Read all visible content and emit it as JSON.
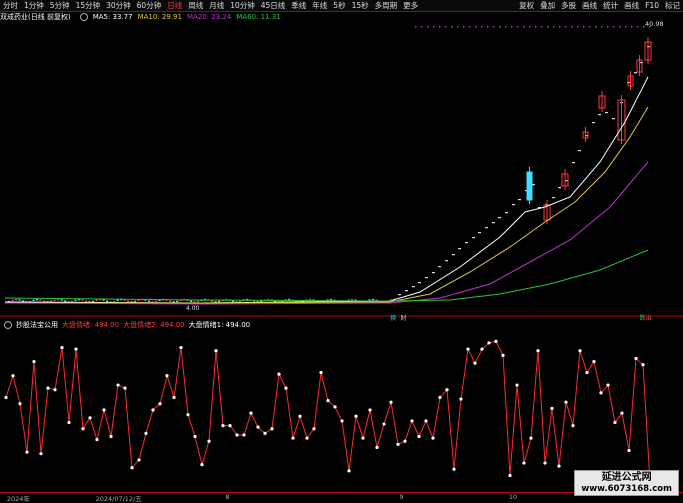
{
  "toolbar": {
    "left": [
      {
        "label": "分时",
        "active": false
      },
      {
        "label": "1分钟",
        "active": false
      },
      {
        "label": "5分钟",
        "active": false
      },
      {
        "label": "15分钟",
        "active": false
      },
      {
        "label": "30分钟",
        "active": false
      },
      {
        "label": "60分钟",
        "active": false
      },
      {
        "label": "日线",
        "active": true
      },
      {
        "label": "周线",
        "active": false
      },
      {
        "label": "月线",
        "active": false
      },
      {
        "label": "10分钟",
        "active": false
      },
      {
        "label": "45日线",
        "active": false
      },
      {
        "label": "季线",
        "active": false
      },
      {
        "label": "年线",
        "active": false
      },
      {
        "label": "5秒",
        "active": false
      },
      {
        "label": "15秒",
        "active": false
      },
      {
        "label": "多周期",
        "active": false
      },
      {
        "label": "更多",
        "active": false
      }
    ],
    "right": [
      "复权",
      "叠加",
      "多股",
      "画线",
      "统计",
      "画线",
      "F10",
      "标记"
    ]
  },
  "stock_info": {
    "name": "双成药业(日线 前复权)",
    "ma5": "MA5: 33.77",
    "ma10": "MA10: 29.91",
    "ma20": "MA20: 23.24",
    "ma60": "MA60: 11.31"
  },
  "price_labels": {
    "top": "40.98",
    "low": "4.00"
  },
  "indicator": {
    "name": "抄股法宝公用",
    "v1": "大盘情绪: 494.00",
    "v2": "大盘情绪2: 494.00",
    "v3": "大盘情绪1: 494.00",
    "series": [
      58,
      72,
      54,
      23,
      81,
      22,
      64,
      63,
      90,
      42,
      89,
      38,
      45,
      31,
      50,
      33,
      66,
      64,
      13,
      18,
      35,
      50,
      54,
      72,
      58,
      90,
      47,
      33,
      15,
      30,
      88,
      40,
      40,
      34,
      34,
      48,
      39,
      35,
      38,
      73,
      64,
      32,
      46,
      32,
      38,
      74,
      56,
      52,
      43,
      11,
      46,
      32,
      50,
      26,
      41,
      55,
      28,
      30,
      43,
      33,
      43,
      32,
      58,
      63,
      12,
      57,
      89,
      80,
      89,
      93,
      94,
      85,
      8,
      66,
      16,
      32,
      88,
      16,
      51,
      14,
      55,
      40,
      88,
      74,
      81,
      61,
      66,
      42,
      48,
      24,
      83,
      79,
      4
    ],
    "colors": {
      "line": "#ff2a2a",
      "dot": "#ffffff"
    }
  },
  "dates": [
    {
      "label": "2024年",
      "pos": 0.01
    },
    {
      "label": "2024/07/12/五",
      "pos": 0.14
    },
    {
      "label": "8",
      "pos": 0.33
    },
    {
      "label": "9",
      "pos": 0.585
    },
    {
      "label": "10",
      "pos": 0.745
    }
  ],
  "markers": [
    {
      "label": "换",
      "pos_x": 0.57,
      "color": "#2ec4ff"
    },
    {
      "label": "财",
      "pos_x": 0.585,
      "color": "#cccccc"
    },
    {
      "label": "跌",
      "pos_x": 0.935,
      "color": "#27d15b"
    },
    {
      "label": "出",
      "pos_x": 0.935,
      "color": "#ff4040"
    }
  ],
  "watermark": {
    "line1": "延进公式网",
    "line2": "www.6073168.com"
  },
  "colors": {
    "up": "#ff3b3b",
    "down": "#3ee0ff",
    "ma5": "#ffffff",
    "ma10": "#e3c83a",
    "ma20": "#c030d0",
    "ma60": "#29c43a",
    "bg": "#000000"
  }
}
